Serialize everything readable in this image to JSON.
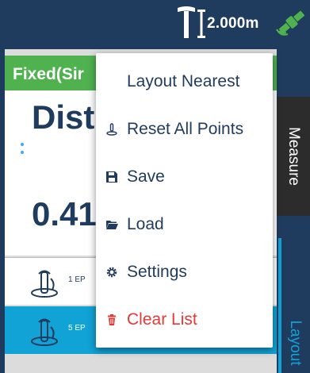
{
  "header": {
    "antenna_height": "2.000m",
    "icons": [
      "survey-pole-icon",
      "height-bracket-icon",
      "satellite-icon"
    ],
    "satellite_color": "#4fb24f"
  },
  "status": {
    "fix_text": "Fixed(Sir",
    "fix_color": "#4fb24f"
  },
  "measurement": {
    "label": "Dist",
    "value": "0.41"
  },
  "points_list": [
    {
      "label": "1 EP",
      "icon": "staking-point-icon"
    },
    {
      "label": "5 EP",
      "icon": "staking-point-icon",
      "selected": true
    }
  ],
  "side_tabs": [
    {
      "label": "Measure",
      "active": false
    },
    {
      "label": "Layout",
      "active": true
    }
  ],
  "menu": {
    "items": [
      {
        "label": "Layout Nearest",
        "icon": ""
      },
      {
        "label": "Reset All Points",
        "icon": "reset-points-icon"
      },
      {
        "label": "Save",
        "icon": "save-icon"
      },
      {
        "label": "Load",
        "icon": "folder-icon"
      },
      {
        "label": "Settings",
        "icon": "gear-icon"
      },
      {
        "label": "Clear List",
        "icon": "trash-icon",
        "color": "#e53935"
      }
    ]
  },
  "colors": {
    "primary": "#1f3b5e",
    "accent": "#11a2d6",
    "fixed": "#4fb24f",
    "danger": "#e53935"
  }
}
